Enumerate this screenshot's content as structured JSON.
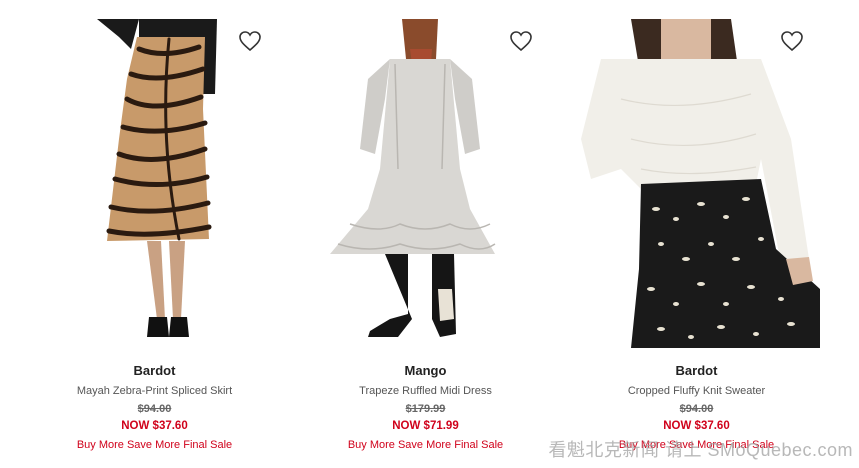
{
  "products": [
    {
      "brand": "Bardot",
      "name": "Mayah Zebra-Print Spliced Skirt",
      "was_price": "$94.00",
      "now_price": "NOW $37.60",
      "promo": "Buy More Save More Final Sale",
      "wishlist_icon": "heart-outline-icon"
    },
    {
      "brand": "Mango",
      "name": "Trapeze Ruffled Midi Dress",
      "was_price": "$179.99",
      "now_price": "NOW $71.99",
      "promo": "Buy More Save More Final Sale",
      "wishlist_icon": "heart-outline-icon"
    },
    {
      "brand": "Bardot",
      "name": "Cropped Fluffy Knit Sweater",
      "was_price": "$94.00",
      "now_price": "NOW $37.60",
      "promo": "Buy More Save More Final Sale",
      "wishlist_icon": "heart-outline-icon"
    }
  ],
  "watermark": "看魁北克新闻 请上 SMoQuebec.com",
  "colors": {
    "sale_red": "#d0021b",
    "text": "#222222",
    "muted": "#555555"
  }
}
